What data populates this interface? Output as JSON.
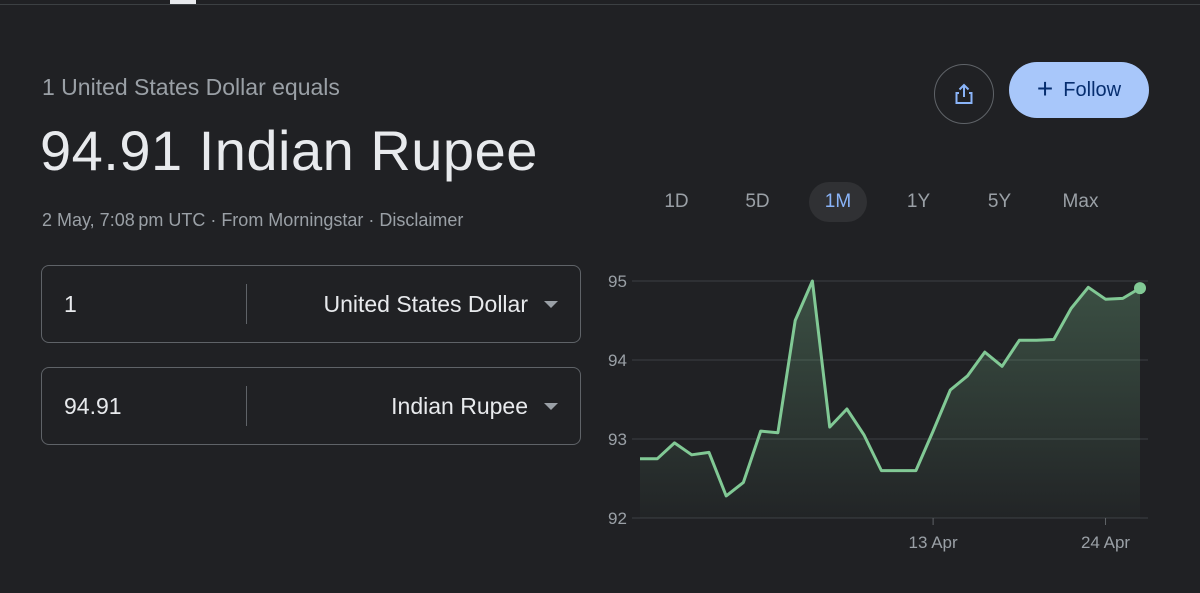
{
  "header": {
    "subtitle": "1 United States Dollar equals",
    "rate": "94.91 Indian Rupee",
    "meta": "2 May, 7:08 pm UTC · From Morningstar · Disclaimer"
  },
  "actions": {
    "share_icon": "share-icon",
    "follow_label": "Follow",
    "follow_icon": "plus-icon"
  },
  "converter": {
    "from": {
      "amount": "1",
      "currency": "United States Dollar"
    },
    "to": {
      "amount": "94.91",
      "currency": "Indian Rupee"
    }
  },
  "ranges": [
    "1D",
    "5D",
    "1M",
    "1Y",
    "5Y",
    "Max"
  ],
  "active_range": "1M",
  "colors": {
    "line": "#81c995",
    "accent": "#a8c7fa",
    "active_range": "#8ab4f8"
  },
  "chart_data": {
    "type": "line",
    "ylim": [
      92,
      95
    ],
    "yticks": [
      95,
      94,
      93,
      92
    ],
    "xtick_labels": [
      "13 Apr",
      "24 Apr"
    ],
    "xtick_index": [
      17,
      27
    ],
    "y": [
      92.75,
      92.75,
      92.95,
      92.8,
      92.83,
      92.28,
      92.45,
      93.1,
      93.08,
      94.5,
      95.0,
      93.15,
      93.38,
      93.05,
      92.6,
      92.6,
      92.6,
      93.1,
      93.62,
      93.8,
      94.1,
      93.92,
      94.25,
      94.25,
      94.26,
      94.65,
      94.92,
      94.77,
      94.78,
      94.91
    ]
  }
}
